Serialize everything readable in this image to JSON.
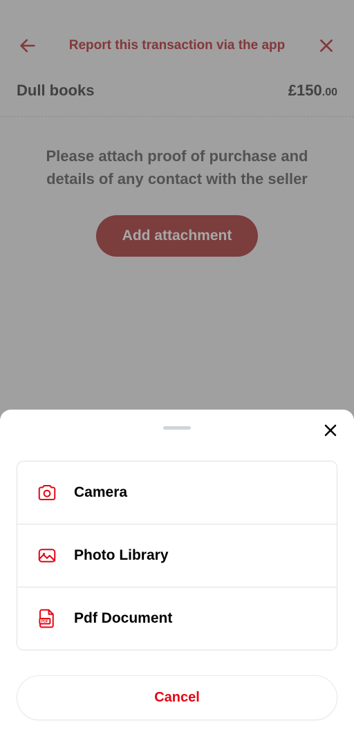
{
  "header": {
    "title": "Report this transaction via the app"
  },
  "transaction": {
    "name": "Dull books",
    "amount_whole": "£150",
    "amount_decimal": ".00"
  },
  "instruction": "Please attach proof of purchase and details of any contact with the seller",
  "add_button_label": "Add attachment",
  "sheet": {
    "options": [
      {
        "label": "Camera"
      },
      {
        "label": "Photo Library"
      },
      {
        "label": "Pdf Document"
      }
    ],
    "cancel_label": "Cancel"
  }
}
